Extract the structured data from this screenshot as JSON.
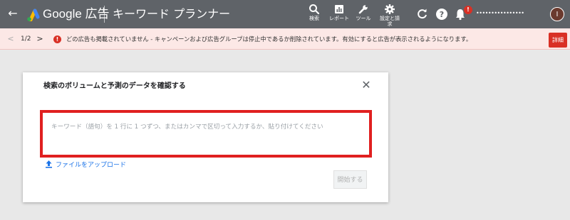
{
  "header": {
    "brand": "Google 広告",
    "tool_title": "キーワード プランナー",
    "nav": {
      "search": "検索",
      "report": "レポート",
      "tools": "ツール",
      "settings_line1": "設定と請",
      "settings_line2": "求"
    },
    "notification_badge": "!",
    "account_name": "••••••••••••••••",
    "avatar_initial": "I"
  },
  "notification": {
    "pager": "1/2",
    "message": "どの広告も掲載されていません - キャンペーンおよび広告グループは停止中であるか削除されています。有効にすると広告が表示されるようになります。",
    "details_label": "詳細"
  },
  "dialog": {
    "title": "検索のボリュームと予測のデータを確認する",
    "placeholder": "キーワード（語句）を 1 行に 1 つずつ、またはカンマで区切って入力するか、貼り付けてください",
    "upload_label": "ファイルをアップロード",
    "start_label": "開始する"
  },
  "colors": {
    "topbar": "#5f6368",
    "alert_red": "#d93025",
    "highlight_border": "#e02020",
    "link_blue": "#1a73e8",
    "notification_bg": "#fce8e6"
  },
  "icons": {
    "back": "arrow-left-icon",
    "search": "search-icon",
    "report": "bar-chart-icon",
    "tools": "wrench-icon",
    "settings": "gear-icon",
    "refresh": "refresh-icon",
    "help": "help-icon",
    "bell": "bell-icon",
    "close": "close-icon",
    "upload": "upload-icon"
  }
}
